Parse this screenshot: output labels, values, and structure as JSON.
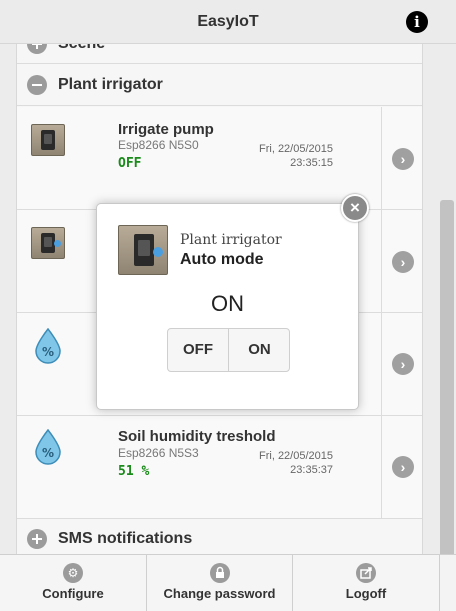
{
  "header": {
    "title": "EasyIoT",
    "info_glyph": "i"
  },
  "sections": {
    "scene_label": "Scene",
    "plant_irrigator_label": "Plant irrigator",
    "sms_label": "SMS notifications"
  },
  "devices": [
    {
      "name": "Irrigate pump",
      "node": "Esp8266 N5S0",
      "value": "OFF",
      "date": "Fri, 22/05/2015",
      "time": "23:35:15",
      "icon": "switch-icon"
    },
    {
      "name": "Auto mode",
      "node": "",
      "value": "",
      "date": "",
      "time": "",
      "icon": "switch-icon"
    },
    {
      "name": "",
      "node": "",
      "value": "",
      "date": "",
      "time": "",
      "icon": "humidity-drop-icon"
    },
    {
      "name": "Soil humidity treshold",
      "node": "Esp8266 N5S3",
      "value": "51 %",
      "date": "Fri, 22/05/2015",
      "time": "23:35:37",
      "icon": "humidity-drop-icon"
    }
  ],
  "popup": {
    "group": "Plant irrigator",
    "name": "Auto mode",
    "state": "ON",
    "off_label": "OFF",
    "on_label": "ON"
  },
  "footer": {
    "configure": "Configure",
    "change_password": "Change password",
    "logoff": "Logoff"
  },
  "colors": {
    "value_green": "#1a8a1a",
    "icon_gray": "#9b9b9b",
    "header_bg": "#ebebeb"
  }
}
